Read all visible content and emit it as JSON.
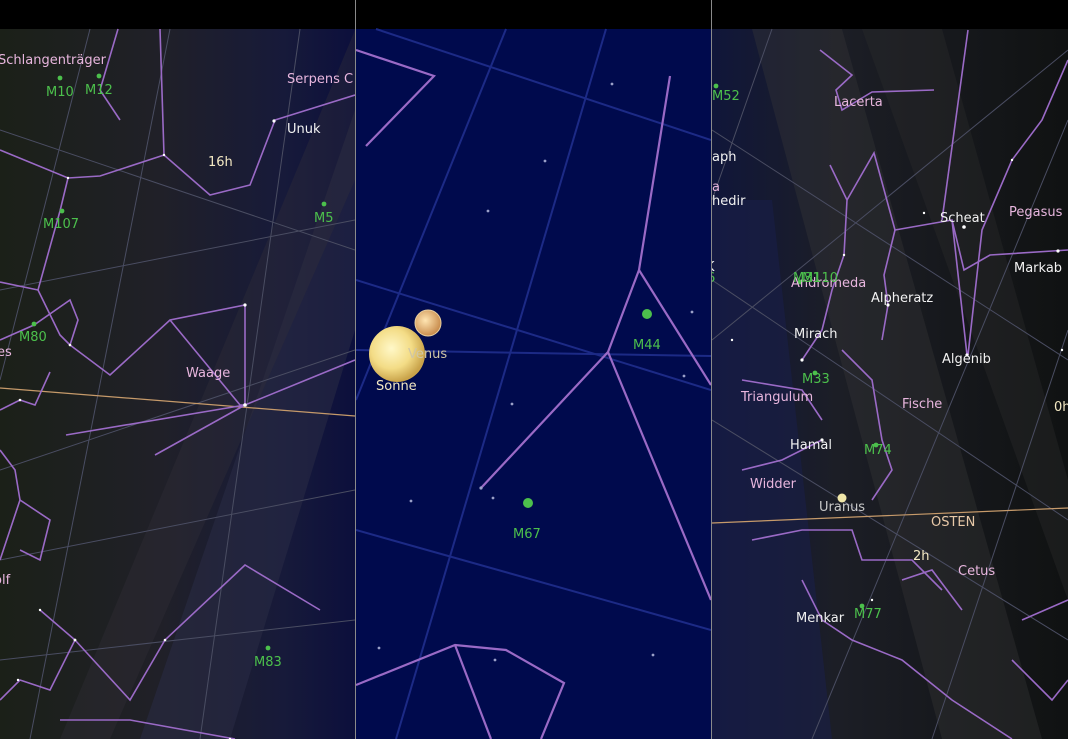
{
  "colors": {
    "background_left": "#15181a",
    "background_mid": "#000a4d",
    "constellation_line": "#9a6ac6",
    "messier_label": "#4cc04c",
    "constellation_label": "#e8b6de",
    "star_label": "#f2f2f2",
    "ecliptic": "#c69a6a"
  },
  "left_panel": {
    "constellations": [
      "Schlangenträger",
      "Serpens C",
      "Waage"
    ],
    "messier": [
      "M10",
      "M12",
      "M107",
      "M5",
      "M80",
      "M83"
    ],
    "stars": [
      "Unuk"
    ],
    "hour_label": "16h",
    "edge_fragments": [
      "es",
      "olf"
    ]
  },
  "mid_panel": {
    "planets": [
      "Venus"
    ],
    "sun": "Sonne",
    "messier": [
      "M44",
      "M67"
    ]
  },
  "right_panel": {
    "constellations": [
      "Lacerta",
      "Andromeda",
      "Pegasus",
      "Triangulum",
      "Fische",
      "Widder",
      "Cetus"
    ],
    "stars": [
      "Scheat",
      "Markab",
      "Alpheratz",
      "Mirach",
      "Algenib",
      "Hamal",
      "Menkar"
    ],
    "messier": [
      "M52",
      "M31",
      "M110",
      "M33",
      "M74",
      "M77"
    ],
    "planets": [
      "Uranus"
    ],
    "direction": "OSTEN",
    "hour_labels": [
      "2h",
      "0h"
    ],
    "edge_fragments": [
      "aph",
      "a",
      "hedir",
      "K",
      "6"
    ]
  }
}
